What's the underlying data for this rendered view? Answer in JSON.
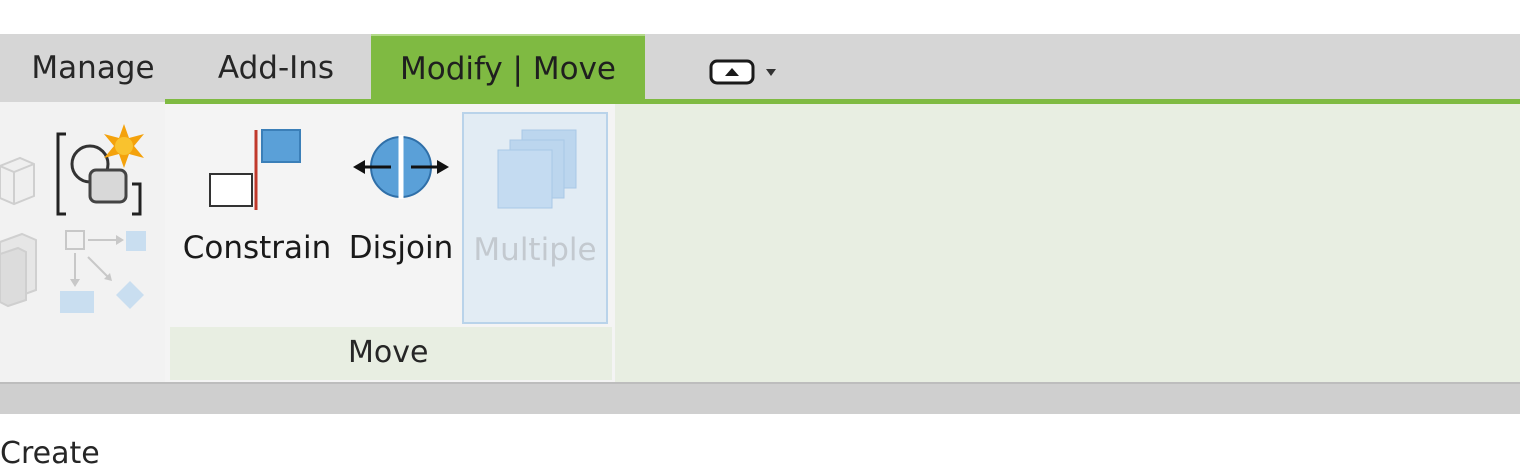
{
  "tabs": [
    {
      "label": "Manage",
      "active": false
    },
    {
      "label": "Add-Ins",
      "active": false
    },
    {
      "label": "Modify | Move",
      "active": true
    }
  ],
  "quick_toggle_icon": "panel-minimize-icon",
  "panels": {
    "create": {
      "label": "Create"
    },
    "move": {
      "label": "Move",
      "tools": [
        {
          "label": "Constrain",
          "icon": "constrain-icon",
          "enabled": true
        },
        {
          "label": "Disjoin",
          "icon": "disjoin-icon",
          "enabled": true
        },
        {
          "label": "Multiple",
          "icon": "multiple-icon",
          "enabled": false,
          "selected": true
        }
      ]
    }
  },
  "colors": {
    "accent_green": "#7fba42",
    "icon_blue": "#5aa0d8",
    "ribbon_bg": "#f4f4f4",
    "contextual_bg": "#e8eee2"
  }
}
